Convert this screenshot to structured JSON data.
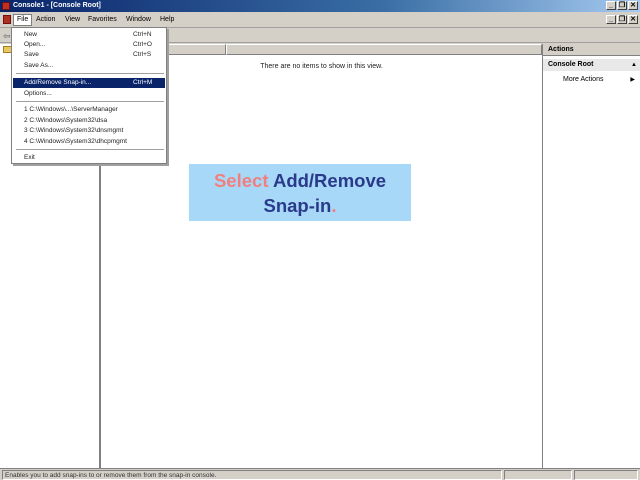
{
  "window": {
    "title": "Console1 - [Console Root]",
    "buttons": [
      "_",
      "❐",
      "✕"
    ]
  },
  "menubar": {
    "items": [
      "File",
      "Action",
      "View",
      "Favorites",
      "Window",
      "Help"
    ]
  },
  "file_menu": {
    "items": [
      {
        "label": "New",
        "shortcut": "Ctrl+N"
      },
      {
        "label": "Open...",
        "shortcut": "Ctrl+O"
      },
      {
        "label": "Save",
        "shortcut": "Ctrl+S"
      },
      {
        "label": "Save As...",
        "shortcut": ""
      },
      {
        "label": "Add/Remove Snap-in...",
        "shortcut": "Ctrl+M"
      },
      {
        "label": "Options...",
        "shortcut": ""
      },
      {
        "label": "1 C:\\Windows\\...\\ServerManager",
        "shortcut": ""
      },
      {
        "label": "2 C:\\Windows\\System32\\dsa",
        "shortcut": ""
      },
      {
        "label": "3 C:\\Windows\\System32\\dnsmgmt",
        "shortcut": ""
      },
      {
        "label": "4 C:\\Windows\\System32\\dhcpmgmt",
        "shortcut": ""
      },
      {
        "label": "Exit",
        "shortcut": ""
      }
    ]
  },
  "center": {
    "empty_message": "There are no items to show in this view."
  },
  "actions": {
    "header": "Actions",
    "group": "Console Root",
    "more": "More Actions"
  },
  "status": {
    "text": "Enables you to add snap-ins to or remove them from the snap-in console."
  },
  "callout": {
    "word1": "Select",
    "word2": "Add/Remove",
    "word3": "Snap-in",
    "dot": "."
  },
  "colors": {
    "highlight": "#0a246a",
    "callout_bg": "#a8d8f8",
    "callout_accent": "#f08080",
    "callout_text": "#2a3a8a"
  }
}
